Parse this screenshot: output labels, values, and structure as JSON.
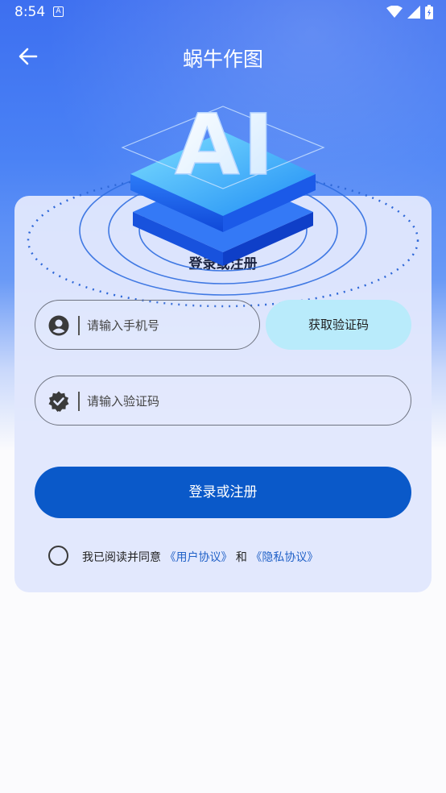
{
  "status_bar": {
    "time": "8:54",
    "notification_icon": "A",
    "icons": [
      "wifi-icon",
      "signal-icon",
      "battery-icon"
    ]
  },
  "header": {
    "back_icon": "arrow-left-icon",
    "title": "蜗牛作图"
  },
  "hero": {
    "logo_text": "AI"
  },
  "card": {
    "title": "登录或注册"
  },
  "phone_field": {
    "icon": "user-icon",
    "placeholder": "请输入手机号"
  },
  "get_code_button": {
    "label": "获取验证码"
  },
  "code_field": {
    "icon": "verified-badge-icon",
    "placeholder": "请输入验证码"
  },
  "login_button": {
    "label": "登录或注册"
  },
  "agreement": {
    "checked": false,
    "prefix": "我已阅读并同意",
    "user_agreement": "《用户协议》",
    "conjunction": "和",
    "privacy_policy": "《隐私协议》"
  },
  "colors": {
    "primary": "#0a59c9",
    "accent_light": "#b9ebfb",
    "link": "#2262c8",
    "header_bg": "#3d6ff0"
  }
}
